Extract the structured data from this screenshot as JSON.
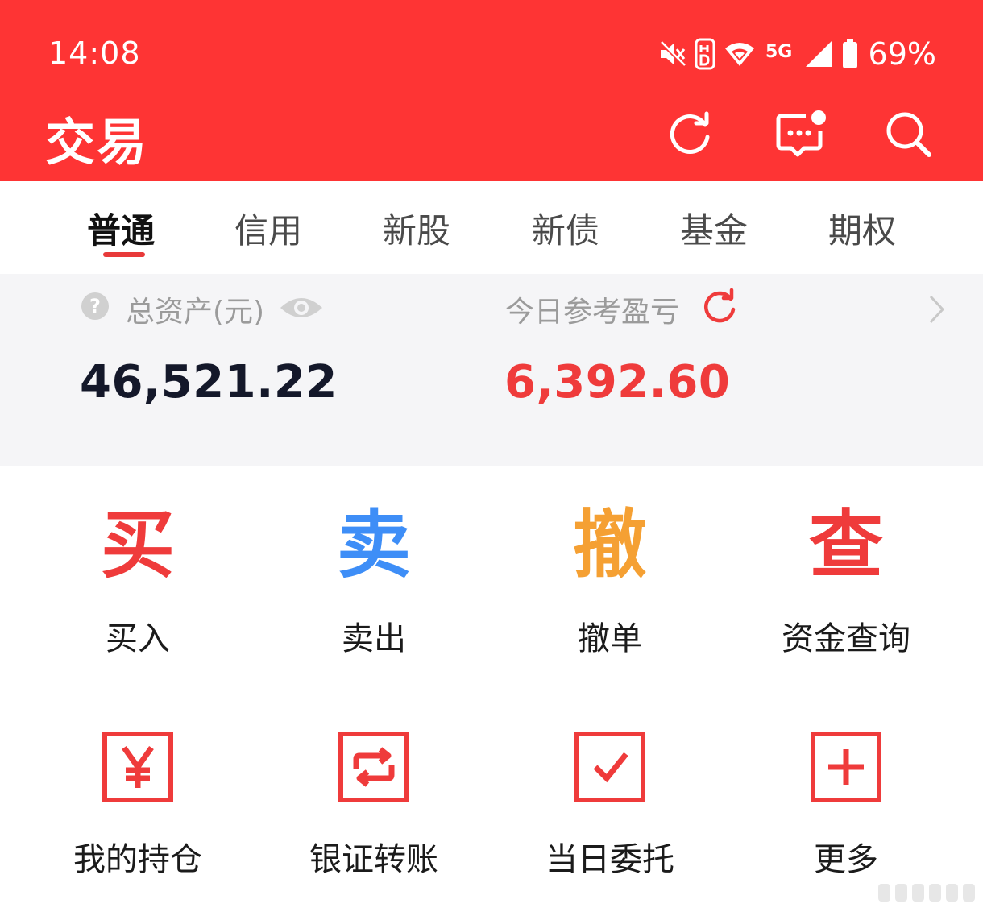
{
  "status_bar": {
    "time": "14:08",
    "battery": "69%",
    "network": "5G",
    "icons": [
      "mute-icon",
      "hd-icon",
      "wifi-icon",
      "5g-icon",
      "signal-icon",
      "battery-icon"
    ]
  },
  "header": {
    "title": "交易",
    "buttons": [
      "refresh-icon",
      "message-icon",
      "search-icon"
    ]
  },
  "tabs": [
    {
      "label": "普通",
      "active": true
    },
    {
      "label": "信用",
      "active": false
    },
    {
      "label": "新股",
      "active": false
    },
    {
      "label": "新债",
      "active": false
    },
    {
      "label": "基金",
      "active": false
    },
    {
      "label": "期权",
      "active": false
    }
  ],
  "assets": {
    "help_glyph": "?",
    "total_label": "总资产(元)",
    "total_value": "46,521.22",
    "pnl_label": "今日参考盈亏",
    "pnl_value": "6,392.60"
  },
  "actions_row1": [
    {
      "glyph": "买",
      "label": "买入",
      "color": "#ef3b3b"
    },
    {
      "glyph": "卖",
      "label": "卖出",
      "color": "#3e8ef7"
    },
    {
      "glyph": "撤",
      "label": "撤单",
      "color": "#f5a033"
    },
    {
      "glyph": "查",
      "label": "资金查询",
      "color": "#ef3b3b"
    }
  ],
  "actions_row2": [
    {
      "icon": "yen-icon",
      "label": "我的持仓"
    },
    {
      "icon": "transfer-icon",
      "label": "银证转账"
    },
    {
      "icon": "check-icon",
      "label": "当日委托"
    },
    {
      "icon": "plus-icon",
      "label": "更多"
    }
  ],
  "colors": {
    "header_bg": "#fe3434",
    "accent_red": "#ef3b3b",
    "accent_blue": "#3e8ef7",
    "accent_orange": "#f5a033",
    "panel_bg": "#f5f5f7"
  }
}
